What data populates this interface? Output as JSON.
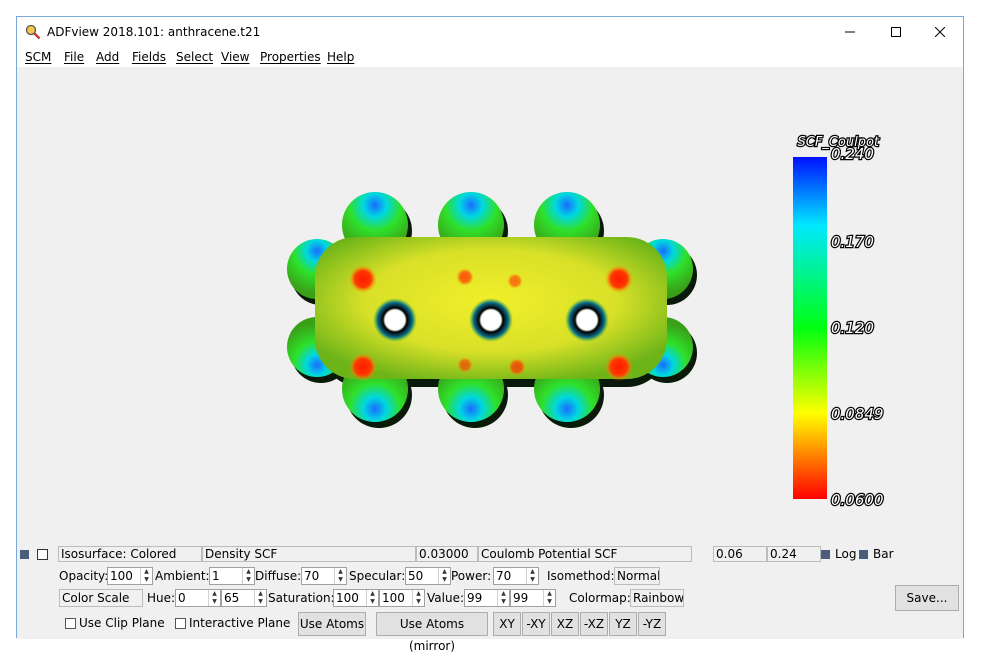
{
  "window": {
    "title": "ADFview 2018.101: anthracene.t21"
  },
  "menu": [
    "SCM",
    "File",
    "Add",
    "Fields",
    "Select",
    "View",
    "Properties",
    "Help"
  ],
  "colorbar": {
    "title": "SCF_Coulpot",
    "ticks": [
      "0.240",
      "0.170",
      "0.120",
      "0.0849",
      "0.0600"
    ]
  },
  "row1": {
    "isosurface": "Isosurface: Colored",
    "density": "Density SCF",
    "iso_value": "0.03000",
    "color_field": "Coulomb Potential SCF",
    "range_min": "0.06",
    "range_max": "0.24",
    "log_label": "Log",
    "bar_label": "Bar"
  },
  "row2": {
    "opacity_label": "Opacity:",
    "opacity": "100",
    "ambient_label": "Ambient:",
    "ambient": "1",
    "diffuse_label": "Diffuse:",
    "diffuse": "70",
    "specular_label": "Specular:",
    "specular": "50",
    "power_label": "Power:",
    "power": "70",
    "isomethod_label": "Isomethod:",
    "isomethod": "Normal"
  },
  "row3": {
    "color_scale": "Color Scale",
    "hue_label": "Hue:",
    "hue_min": "0",
    "hue_max": "65",
    "saturation_label": "Saturation:",
    "sat_min": "100",
    "sat_max": "100",
    "value_label": "Value:",
    "val_min": "99",
    "val_max": "99",
    "colormap_label": "Colormap:",
    "colormap": "Rainbow",
    "save_label": "Save..."
  },
  "row4": {
    "clip_plane": "Use Clip Plane",
    "interactive_plane": "Interactive Plane",
    "use_atoms": "Use Atoms",
    "use_atoms_mirror": "Use Atoms (mirror)",
    "planes": [
      "XY",
      "-XY",
      "XZ",
      "-XZ",
      "YZ",
      "-YZ"
    ]
  }
}
